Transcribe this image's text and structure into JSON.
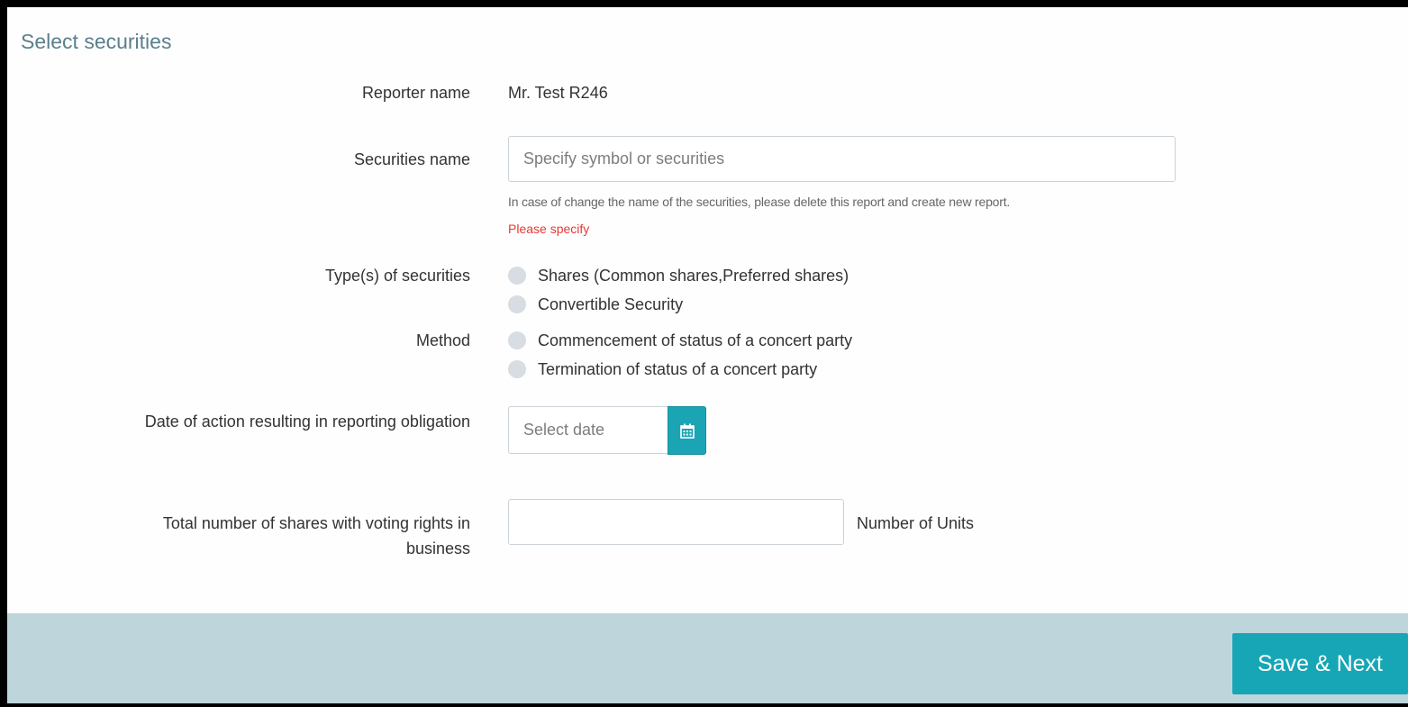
{
  "section": {
    "title": "Select securities"
  },
  "reporter": {
    "label": "Reporter name",
    "value": "Mr. Test R246"
  },
  "securities": {
    "label": "Securities name",
    "placeholder": "Specify symbol or securities",
    "value": "",
    "help": "In case of change the name of the securities, please delete this report and create new report.",
    "error": "Please specify"
  },
  "types": {
    "label": "Type(s) of securities",
    "options": [
      {
        "label": "Shares (Common shares,Preferred shares)",
        "selected": false
      },
      {
        "label": "Convertible Security",
        "selected": false
      }
    ]
  },
  "method": {
    "label": "Method",
    "options": [
      {
        "label": "Commencement of status of a concert party",
        "selected": false
      },
      {
        "label": "Termination of status of a concert party",
        "selected": false
      }
    ]
  },
  "date": {
    "label": "Date of action resulting in reporting obligation",
    "placeholder": "Select date",
    "icon": "calendar-icon"
  },
  "shares": {
    "label_line1": "Total number of shares with voting rights in",
    "label_line2": "business",
    "value": "",
    "unit": "Number of Units"
  },
  "footer": {
    "save_label": "Save & Next"
  },
  "colors": {
    "accent": "#17a6b5",
    "footer_bg": "#bed5dc",
    "title": "#5b7f8c",
    "error": "#e53935",
    "radio": "#d7dde2"
  }
}
